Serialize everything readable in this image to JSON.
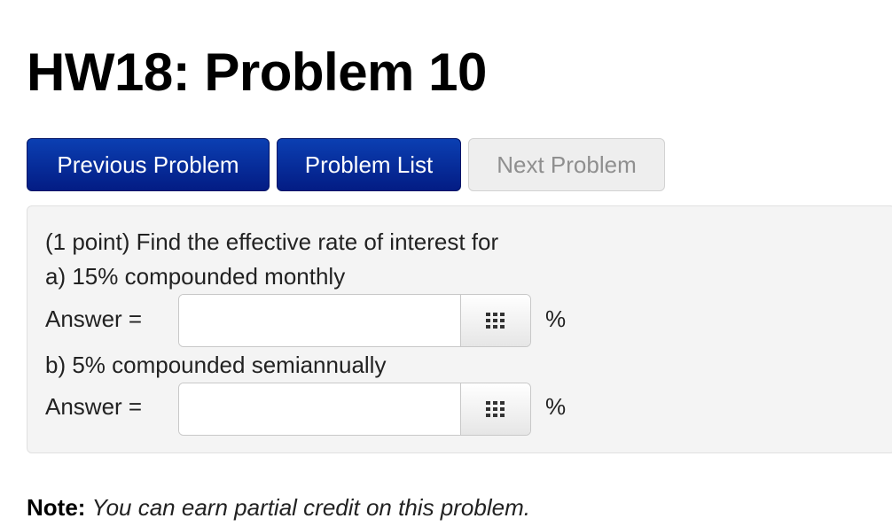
{
  "page": {
    "title": "HW18: Problem 10"
  },
  "nav": {
    "previous_label": "Previous Problem",
    "list_label": "Problem List",
    "next_label": "Next Problem"
  },
  "problem": {
    "intro": "(1 point) Find the effective rate of interest for",
    "part_a": "a) 15% compounded monthly",
    "part_b": "b) 5% compounded semiannually",
    "answers": [
      {
        "label": "Answer =",
        "value": "",
        "placeholder": "",
        "unit": "%",
        "tool_icon": "grid-icon"
      },
      {
        "label": "Answer =",
        "value": "",
        "placeholder": "",
        "unit": "%",
        "tool_icon": "grid-icon"
      }
    ]
  },
  "note": {
    "label": "Note:",
    "text": "You can earn partial credit on this problem."
  },
  "colors": {
    "primary_button": "#031c84",
    "disabled_button": "#eeeeee",
    "panel_background": "#f4f4f4"
  }
}
